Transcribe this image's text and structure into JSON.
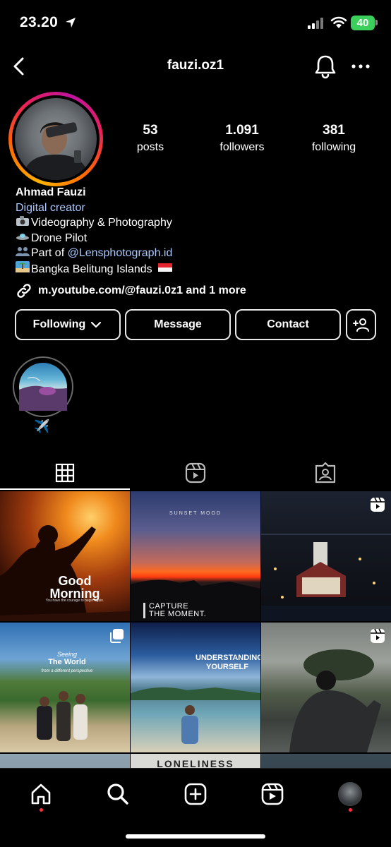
{
  "status_bar": {
    "time": "23.20",
    "battery": "40"
  },
  "header": {
    "username": "fauzi.oz1"
  },
  "stats": [
    {
      "value": "53",
      "label": "posts"
    },
    {
      "value": "1.091",
      "label": "followers"
    },
    {
      "value": "381",
      "label": "following"
    }
  ],
  "bio": {
    "name": "Ahmad Fauzi",
    "category": "Digital creator",
    "line1": "Videography & Photography",
    "line2": "Drone Pilot",
    "line3_prefix": "Part of ",
    "line3_mention": "@Lensphotograph.id",
    "line4": "Bangka Belitung Islands",
    "link": "m.youtube.com/@fauzi.0z1 and 1 more"
  },
  "buttons": {
    "following": "Following",
    "message": "Message",
    "contact": "Contact"
  },
  "highlight": {
    "label": "✈️"
  },
  "posts": [
    {
      "text1": "Good",
      "text2": "Morning",
      "caption": "You have the courage to begin again."
    },
    {
      "title": "SUNSET MOOD",
      "text1": "CAPTURE",
      "text2": "THE MOMENT."
    },
    {
      "type": "reel"
    },
    {
      "text1": "Seeing",
      "text2": "The World",
      "text3": "from a different perspective",
      "type": "carousel"
    },
    {
      "text1": "UNDERSTANDING",
      "text2": "YOURSELF"
    },
    {
      "type": "reel"
    },
    {
      "text1": "LONELINESS"
    }
  ],
  "icons": {
    "back": "chevron-left-icon",
    "bell": "bell-icon",
    "more": "more-horizontal-icon",
    "link": "link-icon",
    "grid_tab": "grid-icon",
    "reels_tab": "reels-icon",
    "tagged_tab": "tagged-icon",
    "home": "home-icon",
    "search": "search-icon",
    "create": "create-icon",
    "reels": "reels-icon",
    "profile": "profile-avatar"
  },
  "colors": {
    "accent_link": "#a8c8ff",
    "notification_dot": "#ff3040",
    "battery": "#3bcf5b"
  }
}
